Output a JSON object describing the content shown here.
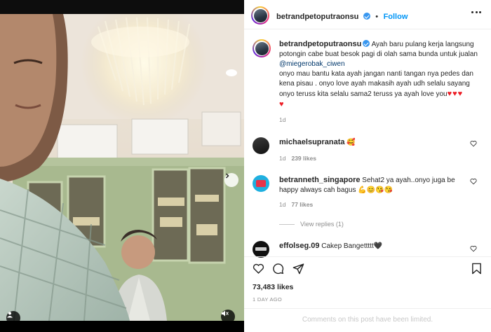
{
  "post": {
    "author": "betrandpetoputraonsu",
    "follow_label": "Follow",
    "caption_user": "betrandpetoputraonsu",
    "caption_text_1": " Ayah baru pulang kerja langsung potongin cabe buat besok pagi di olah sama bunda untuk jualan ",
    "caption_mention": "@miegerobak_ciwen",
    "caption_text_2": "onyo mau bantu kata ayah jangan nanti tangan nya pedes dan kena pisau . onyo love ayah makasih ayah udh selalu sayang onyo teruss kita selalu sama2 teruss ya ayah love you",
    "caption_hearts_a": "♥♥♥",
    "caption_hearts_b": "♥",
    "caption_time": "1d",
    "likes": "73,483 likes",
    "date": "1 DAY AGO",
    "comments_limited": "Comments on this post have been limited."
  },
  "comments": [
    {
      "user": "michaelsupranata",
      "text": " 🥰",
      "time": "1d",
      "likes": "239 likes"
    },
    {
      "user": "betranneth_singapore",
      "text": " Sehat2 ya ayah..onyo juga be happy always cah bagus 💪😊😘😘",
      "time": "1d",
      "likes": "77 likes",
      "replies": "View replies (1)"
    },
    {
      "user": "effolseg.09",
      "text": " Cakep Bangettttt🖤"
    }
  ],
  "icons": [
    "more-icon",
    "like-icon",
    "comment-icon",
    "share-icon",
    "save-icon",
    "next-arrow-icon",
    "user-tag-icon",
    "mute-icon",
    "verified-icon"
  ],
  "colors": {
    "accent": "#0095f6",
    "heart": "#ed1c24",
    "verified": "#3897f0"
  }
}
